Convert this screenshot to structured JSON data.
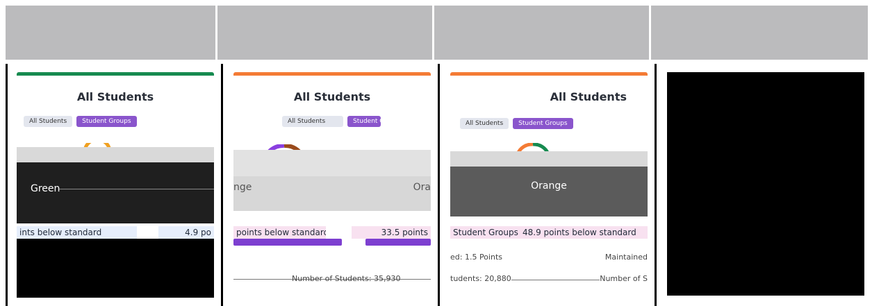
{
  "colors": {
    "green": "#168a4f",
    "orange": "#f47b35",
    "purple": "#7d3fd0",
    "header_grey": "#bbbbbd"
  },
  "cards": [
    {
      "title": "All Students",
      "toggle": [
        "All Students",
        "Student Groups"
      ],
      "level": "Green",
      "stat": "ints below standard",
      "stat_right": "4.9 po"
    },
    {
      "title": "All Students",
      "toggle": [
        "All Students",
        "Student Groups"
      ],
      "level_left": "nge",
      "level_right": "Ora",
      "stat": "points below standard",
      "stat_right": "33.5 points",
      "sub_line": "Number of Students: 35,930"
    },
    {
      "title": "All Students",
      "toggle": [
        "All Students",
        "Student Groups"
      ],
      "level": "Orange",
      "stat": "Student Groups",
      "stat_right": "48.9 points below standard",
      "sub_left": "ed: 1.5 Points",
      "sub_right": "Maintained",
      "sub_line": "tudents: 20,880",
      "sub_line_right": "Number of S"
    }
  ]
}
